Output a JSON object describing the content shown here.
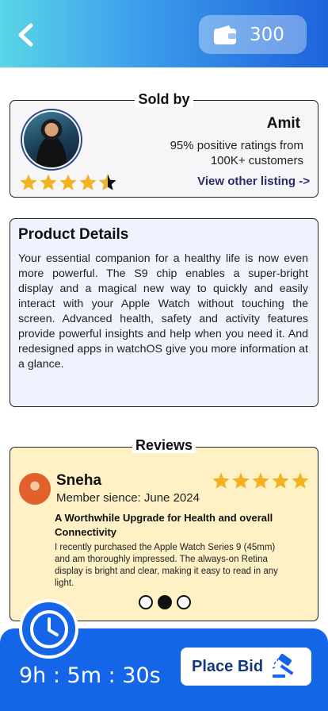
{
  "header": {
    "wallet_amount": "300"
  },
  "seller": {
    "section_title": "Sold by",
    "name": "Amit",
    "rating_text": "95% positive ratings from 100K+ customers",
    "star_rating": 4.5,
    "view_link": "View other listing ->"
  },
  "product": {
    "title": "Product Details",
    "description": "Your essential companion for a healthy life is now even more powerful. The S9 chip enables a super-bright display and a magical new way to quickly and easily interact with your Apple Watch without touching the screen. Advanced health, safety and activity features provide powerful insights and help when you need it. And redesigned apps in watchOS give you more information at a glance."
  },
  "reviews": {
    "section_title": "Reviews",
    "current_index": 1,
    "total": 3,
    "item": {
      "name": "Sneha",
      "member_since": "Member sience: June 2024",
      "star_rating": 5,
      "title": "A Worthwhile Upgrade for Health and overall Connectivity",
      "body": "I recently purchased the Apple Watch Series 9 (45mm) and am thoroughly impressed. The always-on Retina display is bright and clear, making it easy to read in any light."
    }
  },
  "bottom": {
    "timer": "9h : 5m : 30s",
    "bid_label": "Place Bid"
  },
  "colors": {
    "primary": "#1565e8",
    "star": "#f3b21f",
    "review_bg": "#fdf1c5",
    "details_bg": "#eef3fd"
  }
}
